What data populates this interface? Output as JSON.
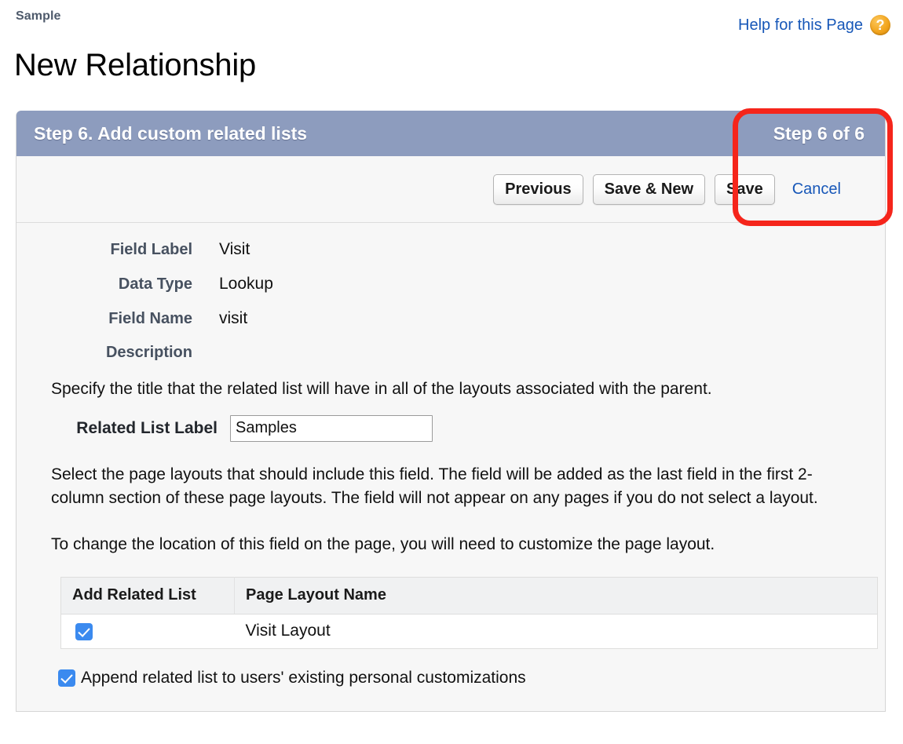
{
  "header": {
    "breadcrumb": "Sample",
    "title": "New Relationship",
    "help_label": "Help for this Page",
    "help_icon_glyph": "?",
    "help_icon_name": "question-mark-help-icon",
    "link_color": "#1757b8"
  },
  "wizard": {
    "step_title": "Step 6. Add custom related lists",
    "step_count": "Step 6 of 6",
    "header_color": "#8d9cbe",
    "toolbar": {
      "previous_label": "Previous",
      "save_and_new_label": "Save & New",
      "save_label": "Save",
      "cancel_label": "Cancel"
    }
  },
  "fields": [
    {
      "label": "Field Label",
      "value": "Visit"
    },
    {
      "label": "Data Type",
      "value": "Lookup"
    },
    {
      "label": "Field Name",
      "value": "visit"
    },
    {
      "label": "Description",
      "value": ""
    }
  ],
  "related_list": {
    "instruction": "Specify the title that the related list will have in all of the layouts associated with the parent.",
    "label": "Related List Label",
    "value": "Samples",
    "placeholder": ""
  },
  "layout_info": {
    "paragraph_1": "Select the page layouts that should include this field. The field will be added as the last field in the first 2-column section of these page layouts. The field will not appear on any pages if you do not select a layout.",
    "paragraph_2": "To change the location of this field on the page, you will need to customize the page layout."
  },
  "layout_table": {
    "columns": [
      "Add Related List",
      "Page Layout Name"
    ],
    "rows": [
      {
        "checked": true,
        "layout_name": "Visit Layout"
      }
    ]
  },
  "append_option": {
    "label": "Append related list to users' existing personal customizations",
    "checked": true
  },
  "annotation": {
    "color": "#f5251b",
    "target": "save-button-and-step-count"
  },
  "colors": {
    "checkbox_blue": "#3b8aef",
    "card_background": "#f7f7f7",
    "table_header_background": "#f0f1f2"
  }
}
